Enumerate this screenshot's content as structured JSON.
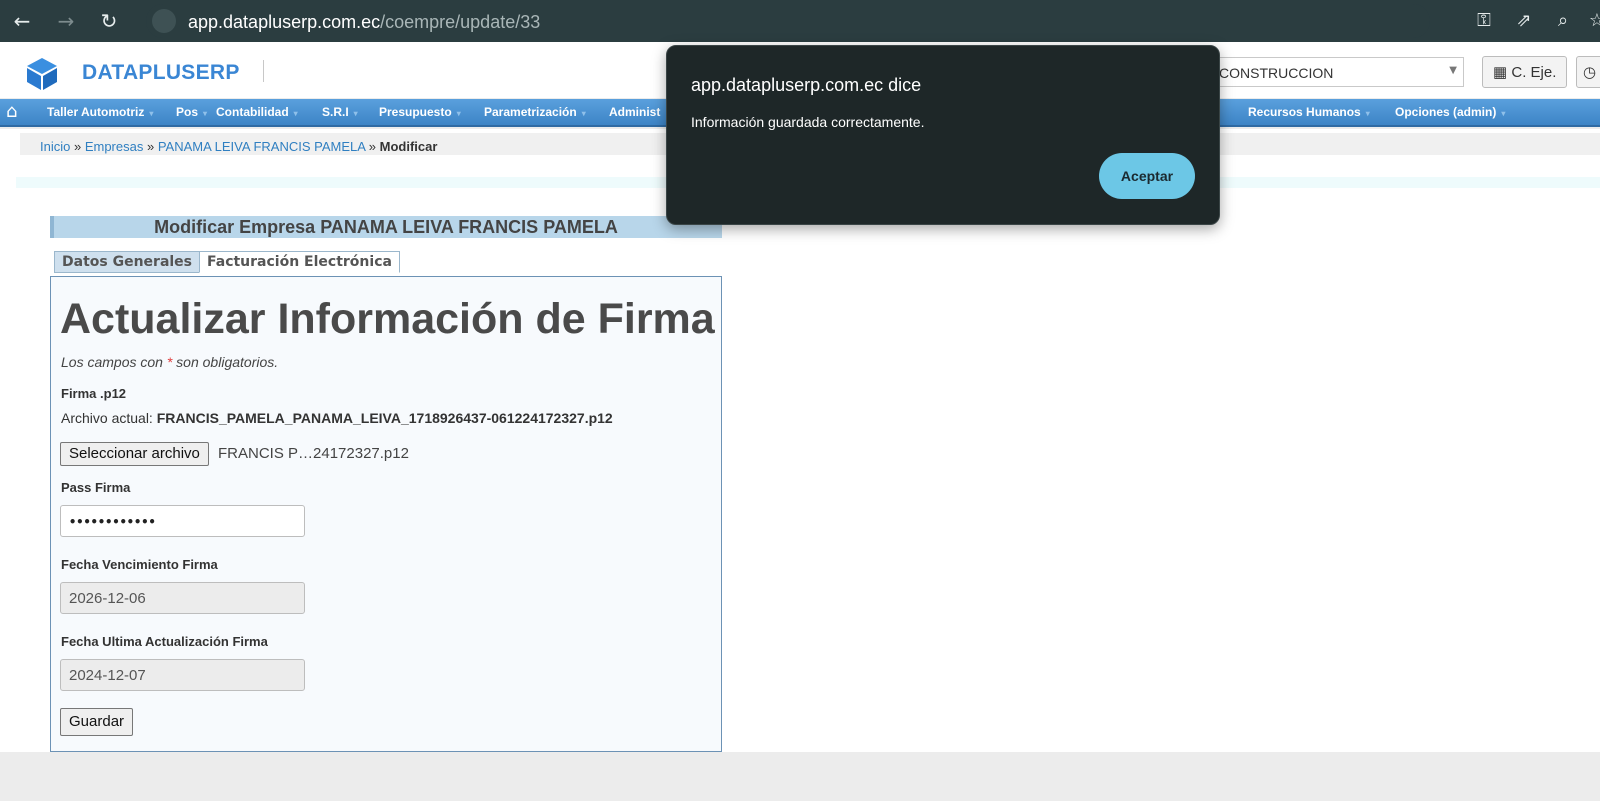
{
  "browser": {
    "url_host": "app.datapluserp.com.ec",
    "url_path": "/coempre/update/33"
  },
  "app": {
    "brand": "DATAPLUSERP",
    "select_value": "CONSTRUCCION",
    "ceje_button": "C. Eje."
  },
  "menu": {
    "items": [
      "Taller Automotriz",
      "Pos",
      "Contabilidad",
      "S.R.I",
      "Presupuesto",
      "Parametrización",
      "Administ",
      "Recursos Humanos",
      "Opciones (admin)"
    ]
  },
  "breadcrumb": {
    "inicio": "Inicio",
    "sep": " » ",
    "empresas": "Empresas",
    "empresa": "PANAMA LEIVA FRANCIS PAMELA",
    "current": "Modificar"
  },
  "form": {
    "title": "Modificar Empresa PANAMA LEIVA FRANCIS PAMELA",
    "tabs": [
      "Datos Generales",
      "Facturación Electrónica"
    ],
    "heading": "Actualizar Información de Firma",
    "note_before": "Los campos con ",
    "note_star": "*",
    "note_after": " son obligatorios.",
    "firma_label": "Firma .p12",
    "current_file_prefix": "Archivo actual: ",
    "current_file": "FRANCIS_PAMELA_PANAMA_LEIVA_1718926437-061224172327.p12",
    "file_button": "Seleccionar archivo",
    "file_chosen": "FRANCIS P…24172327.p12",
    "pass_label": "Pass Firma",
    "pass_value": "••••••••••••",
    "venc_label": "Fecha Vencimiento Firma",
    "venc_value": "2026-12-06",
    "ult_label": "Fecha Ultima Actualización Firma",
    "ult_value": "2024-12-07",
    "save_button": "Guardar"
  },
  "dialog": {
    "title": "app.datapluserp.com.ec dice",
    "message": "Información guardada correctamente.",
    "button": "Aceptar"
  },
  "colors": {
    "accent": "#3a86d4",
    "menubar": "#3d84c6",
    "dialog_bg": "#1e2728",
    "dialog_button": "#6cc7e6"
  }
}
